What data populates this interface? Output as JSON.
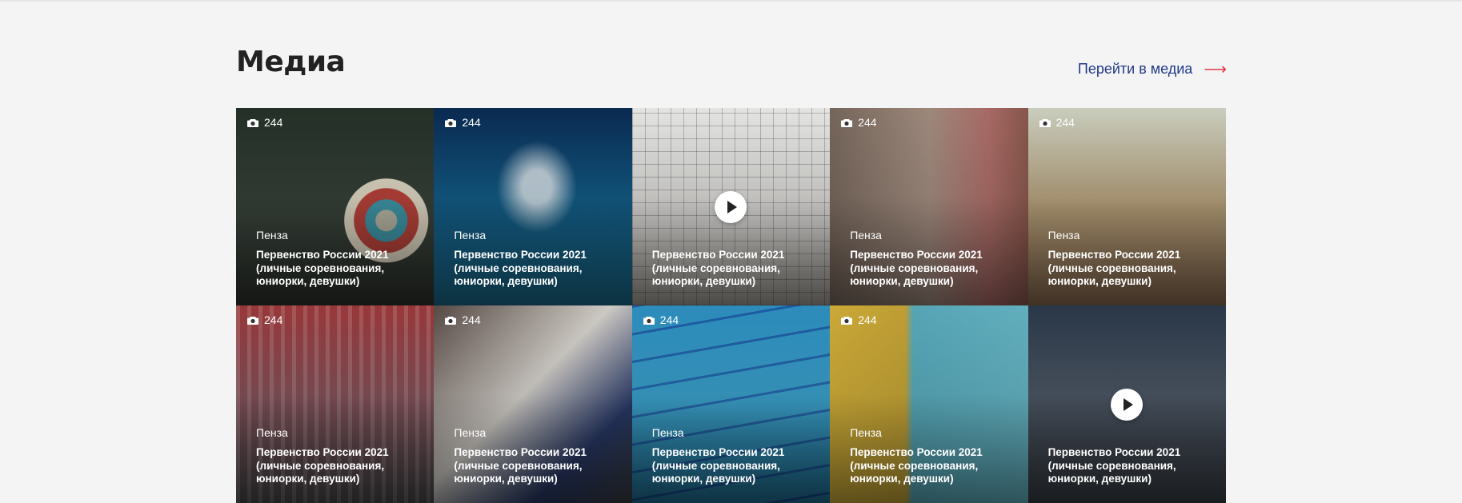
{
  "section": {
    "title": "Медиа",
    "link_label": "Перейти в медиа",
    "link_arrow": "⟶"
  },
  "tiles": [
    {
      "count": "244",
      "city": "Пенза",
      "caption": "Первенство России 2021 (личные соревнования, юниорки, девушки)",
      "type": "photo",
      "icon": "camera-icon"
    },
    {
      "count": "244",
      "city": "Пенза",
      "caption": "Первенство России 2021 (личные соревнования, юниорки, девушки)",
      "type": "photo",
      "icon": "camera-icon"
    },
    {
      "count": "",
      "city": "",
      "caption": "Первенство России 2021 (личные соревнования, юниорки, девушки)",
      "type": "video",
      "icon": "play-icon"
    },
    {
      "count": "244",
      "city": "Пенза",
      "caption": "Первенство России 2021 (личные соревнования, юниорки, девушки)",
      "type": "photo",
      "icon": "camera-icon"
    },
    {
      "count": "244",
      "city": "Пенза",
      "caption": "Первенство России 2021 (личные соревнования, юниорки, девушки)",
      "type": "photo",
      "icon": "camera-icon"
    },
    {
      "count": "244",
      "city": "Пенза",
      "caption": "Первенство России 2021 (личные соревнования, юниорки, девушки)",
      "type": "photo",
      "icon": "camera-icon"
    },
    {
      "count": "244",
      "city": "Пенза",
      "caption": "Первенство России 2021 (личные соревнования, юниорки, девушки)",
      "type": "photo",
      "icon": "camera-icon"
    },
    {
      "count": "244",
      "city": "Пенза",
      "caption": "Первенство России 2021 (личные соревнования, юниорки, девушки)",
      "type": "photo",
      "icon": "camera-icon"
    },
    {
      "count": "244",
      "city": "Пенза",
      "caption": "Первенство России 2021 (личные соревнования, юниорки, девушки)",
      "type": "photo",
      "icon": "camera-icon"
    },
    {
      "count": "",
      "city": "",
      "caption": "Первенство России 2021 (личные соревнования, юниорки, девушки)",
      "type": "video",
      "icon": "play-icon"
    }
  ],
  "colors": {
    "background": "#f4f4f4",
    "title": "#222222",
    "link": "#223a8a",
    "link_arrow": "#e03a4f",
    "overlay_text": "#ffffff"
  }
}
